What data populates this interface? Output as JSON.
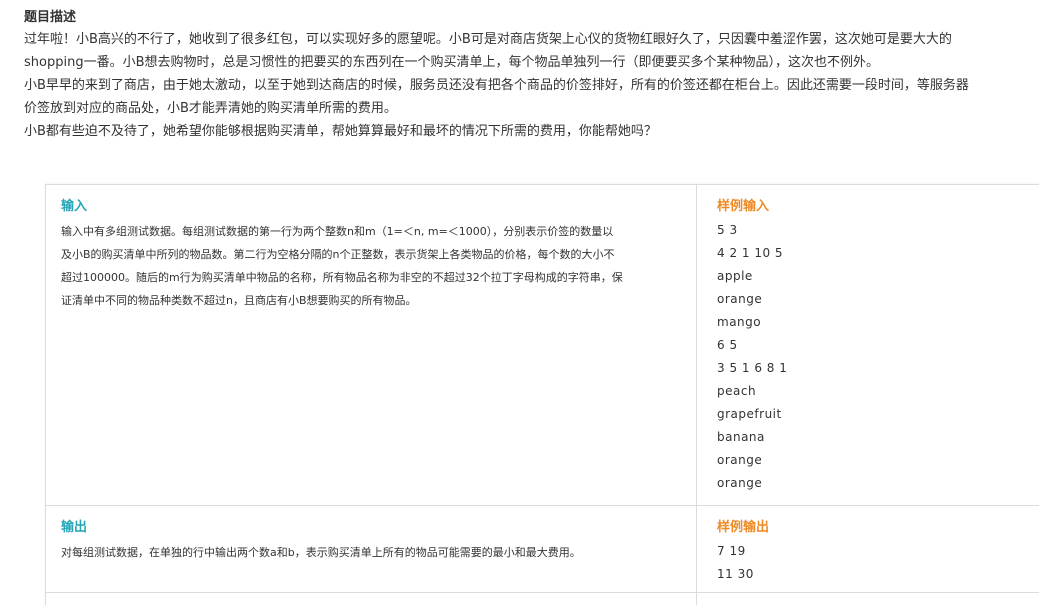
{
  "description": {
    "title": "题目描述",
    "lines": [
      "过年啦！小B高兴的不行了，她收到了很多红包，可以实现好多的愿望呢。小B可是对商店货架上心仪的货物红眼好久了，只因囊中羞涩作罢，这次她可是要大大的",
      "shopping一番。小B想去购物时，总是习惯性的把要买的东西列在一个购买清单上，每个物品单独列一行（即便要买多个某种物品），这次也不例外。",
      "小B早早的来到了商店，由于她太激动，以至于她到达商店的时候，服务员还没有把各个商品的价签排好，所有的价签还都在柜台上。因此还需要一段时间，等服务器",
      "价签放到对应的商品处，小B才能弄清她的购买清单所需的费用。",
      "小B都有些迫不及待了，她希望你能够根据购买清单，帮她算算最好和最坏的情况下所需的费用，你能帮她吗？"
    ]
  },
  "input_section": {
    "label": "输入",
    "lines": [
      "输入中有多组测试数据。每组测试数据的第一行为两个整数n和m（1=＜n, m=＜1000），分别表示价签的数量以",
      "及小B的购买清单中所列的物品数。第二行为空格分隔的n个正整数，表示货架上各类物品的价格，每个数的大小不",
      "超过100000。随后的m行为购买清单中物品的名称，所有物品名称为非空的不超过32个拉丁字母构成的字符串，保",
      "证清单中不同的物品种类数不超过n，且商店有小B想要购买的所有物品。"
    ]
  },
  "sample_input": {
    "label": "样例输入",
    "lines": [
      "5 3",
      "4 2 1 10 5",
      "apple",
      "orange",
      "mango",
      "6 5",
      "3 5 1 6 8 1",
      "peach",
      "grapefruit",
      "banana",
      "orange",
      "orange"
    ]
  },
  "output_section": {
    "label": "输出",
    "lines": [
      "对每组测试数据，在单独的行中输出两个数a和b，表示购买清单上所有的物品可能需要的最小和最大费用。"
    ]
  },
  "sample_output": {
    "label": "样例输出",
    "lines": [
      "7 19",
      "11 30"
    ]
  }
}
